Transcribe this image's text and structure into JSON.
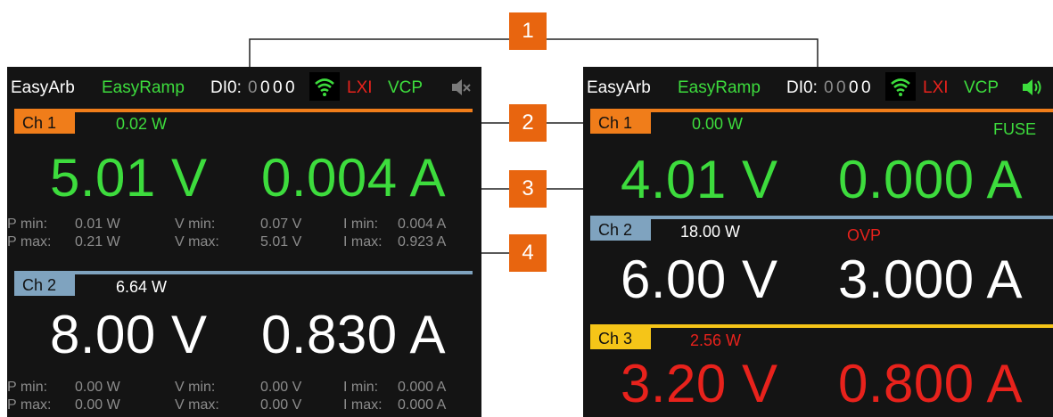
{
  "callouts": [
    "1",
    "2",
    "3",
    "4"
  ],
  "colors": {
    "channel1": "#f07d1a",
    "channel2": "#7fa3bf",
    "channel3": "#f5c518",
    "value_green": "#3ddc3d",
    "value_white": "#ffffff",
    "value_red": "#e8221c",
    "callout": "#e8650f"
  },
  "left_screen": {
    "status_bar": {
      "easyarb": "EasyArb",
      "easyramp": "EasyRamp",
      "dio_label": "DI0:",
      "dio_bits": [
        "0",
        "0",
        "0",
        "0"
      ],
      "wifi_icon": "wifi-icon",
      "lxi": "LXI",
      "vcp": "VCP",
      "speaker_icon": "speaker-muted-icon"
    },
    "ch1": {
      "tag": "Ch 1",
      "power": "0.02 W",
      "voltage": "5.01 V",
      "current": "0.004 A",
      "stats": {
        "p_min_label": "P min:",
        "p_min": "0.01 W",
        "v_min_label": "V min:",
        "v_min": "0.07 V",
        "i_min_label": "I min:",
        "i_min": "0.004 A",
        "p_max_label": "P max:",
        "p_max": "0.21 W",
        "v_max_label": "V max:",
        "v_max": "5.01 V",
        "i_max_label": "I max:",
        "i_max": "0.923 A"
      }
    },
    "ch2": {
      "tag": "Ch 2",
      "power": "6.64 W",
      "voltage": "8.00 V",
      "current": "0.830 A",
      "stats": {
        "p_min_label": "P min:",
        "p_min": "0.00 W",
        "v_min_label": "V min:",
        "v_min": "0.00 V",
        "i_min_label": "I min:",
        "i_min": "0.000 A",
        "p_max_label": "P max:",
        "p_max": "0.00 W",
        "v_max_label": "V max:",
        "v_max": "0.00 V",
        "i_max_label": "I max:",
        "i_max": "0.000 A"
      }
    }
  },
  "right_screen": {
    "status_bar": {
      "easyarb": "EasyArb",
      "easyramp": "EasyRamp",
      "dio_label": "DI0:",
      "dio_bits": [
        "0",
        "0",
        "0",
        "0"
      ],
      "wifi_icon": "wifi-icon",
      "lxi": "LXI",
      "vcp": "VCP",
      "speaker_icon": "speaker-on-icon"
    },
    "ch1": {
      "tag": "Ch 1",
      "power": "0.00 W",
      "flag": "FUSE",
      "voltage": "4.01 V",
      "current": "0.000 A"
    },
    "ch2": {
      "tag": "Ch 2",
      "power": "18.00 W",
      "flag": "OVP",
      "voltage": "6.00 V",
      "current": "3.000 A"
    },
    "ch3": {
      "tag": "Ch 3",
      "power": "2.56 W",
      "voltage": "3.20 V",
      "current": "0.800 A"
    }
  }
}
